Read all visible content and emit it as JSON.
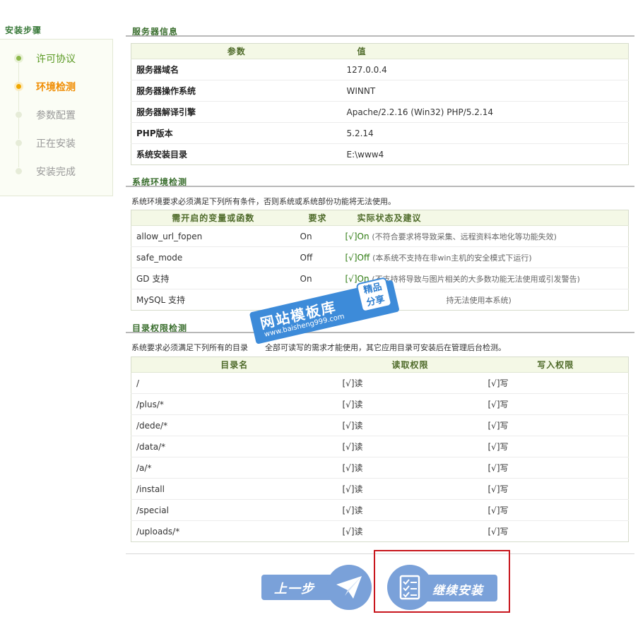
{
  "sidebar": {
    "title": "安装步骤",
    "steps": [
      {
        "label": "许可协议",
        "state": "done"
      },
      {
        "label": "环境检测",
        "state": "current"
      },
      {
        "label": "参数配置",
        "state": "pending"
      },
      {
        "label": "正在安装",
        "state": "pending"
      },
      {
        "label": "安装完成",
        "state": "pending"
      }
    ]
  },
  "server_info": {
    "title": "服务器信息",
    "headers": [
      "参数",
      "值"
    ],
    "rows": [
      {
        "name": "服务器域名",
        "value": "127.0.0.4"
      },
      {
        "name": "服务器操作系统",
        "value": "WINNT"
      },
      {
        "name": "服务器解译引擎",
        "value": "Apache/2.2.16 (Win32) PHP/5.2.14"
      },
      {
        "name": "PHP版本",
        "value": "5.2.14"
      },
      {
        "name": "系统安装目录",
        "value": "E:\\www4"
      }
    ]
  },
  "env_check": {
    "title": "系统环境检测",
    "note": "系统环境要求必须满足下列所有条件，否则系统或系统部份功能将无法使用。",
    "headers": [
      "需开启的变量或函数",
      "要求",
      "实际状态及建议"
    ],
    "rows": [
      {
        "name": "allow_url_fopen",
        "req": "On",
        "status": "[√]On",
        "hint": "(不符合要求将导致采集、远程资料本地化等功能失效)"
      },
      {
        "name": "safe_mode",
        "req": "Off",
        "status": "[√]Off",
        "hint": "(本系统不支持在非win主机的安全模式下运行)"
      },
      {
        "name": "GD 支持",
        "req": "On",
        "status": "[√]On",
        "hint": "(不支持将导致与图片相关的大多数功能无法使用或引发警告)"
      },
      {
        "name": "MySQL 支持",
        "req": "",
        "status": "",
        "hint": "持无法使用本系统)"
      }
    ]
  },
  "dir_check": {
    "title": "目录权限检测",
    "note": "系统要求必须满足下列所有的目录",
    "note_tail": "全部可读写的需求才能使用，其它应用目录可安装后在管理后台检测。",
    "headers": [
      "目录名",
      "读取权限",
      "写入权限"
    ],
    "rows": [
      {
        "dir": "/",
        "read": "[√]读",
        "write": "[√]写"
      },
      {
        "dir": "/plus/*",
        "read": "[√]读",
        "write": "[√]写"
      },
      {
        "dir": "/dede/*",
        "read": "[√]读",
        "write": "[√]写"
      },
      {
        "dir": "/data/*",
        "read": "[√]读",
        "write": "[√]写"
      },
      {
        "dir": "/a/*",
        "read": "[√]读",
        "write": "[√]写"
      },
      {
        "dir": "/install",
        "read": "[√]读",
        "write": "[√]写"
      },
      {
        "dir": "/special",
        "read": "[√]读",
        "write": "[√]写"
      },
      {
        "dir": "/uploads/*",
        "read": "[√]读",
        "write": "[√]写"
      }
    ]
  },
  "watermark": {
    "main": "网站模板库",
    "url": "www.baisheng999.com",
    "badge_line1": "精品",
    "badge_line2": "分享"
  },
  "buttons": {
    "prev": "上一步",
    "next": "继续安装"
  },
  "colors": {
    "button_blue": "#7aa1d9",
    "highlight_red": "#c8161d",
    "ok_green": "#2d7a10",
    "current_orange": "#f08c00"
  }
}
